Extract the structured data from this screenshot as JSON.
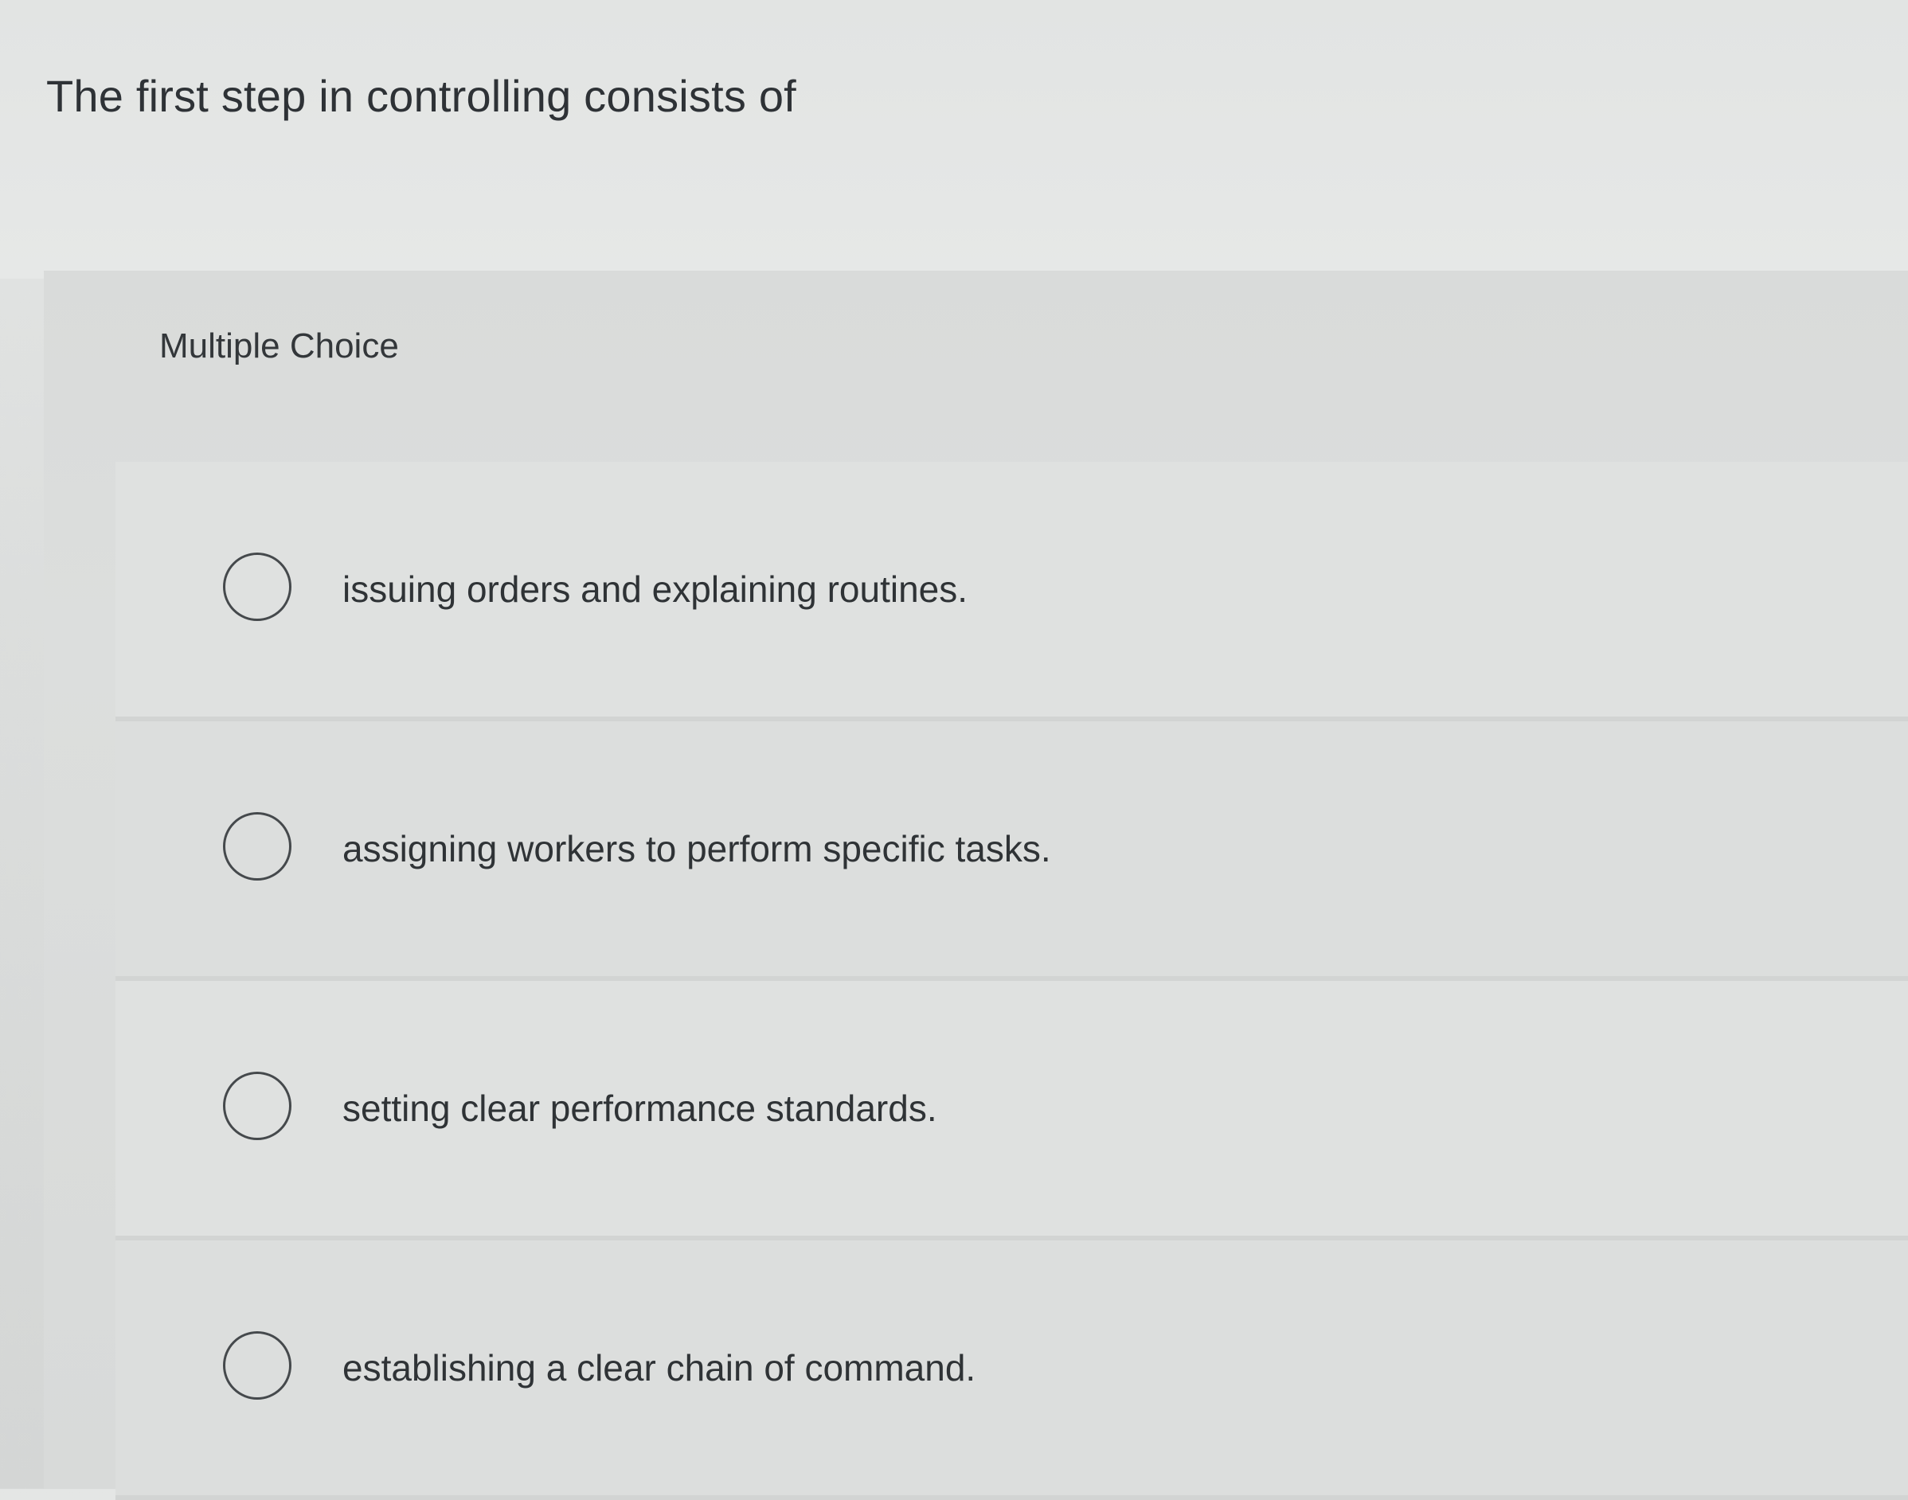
{
  "question": {
    "text": "The first step in controlling consists of"
  },
  "answer_panel": {
    "type_label": "Multiple Choice",
    "options": [
      {
        "label": "issuing orders and explaining routines."
      },
      {
        "label": "assigning workers to perform specific tasks."
      },
      {
        "label": "setting clear performance standards."
      },
      {
        "label": "establishing a clear chain of command."
      }
    ]
  }
}
